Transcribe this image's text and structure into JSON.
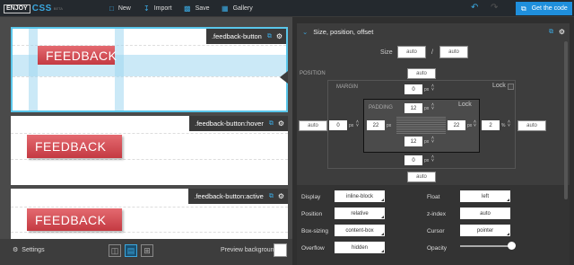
{
  "topbar": {
    "logo_enjoy": "ENJOY",
    "logo_css": "CSS",
    "logo_beta": "BETA",
    "new_label": "New",
    "import_label": "Import",
    "save_label": "Save",
    "gallery_label": "Gallery",
    "get_code_label": "Get the code"
  },
  "previews": [
    {
      "selector": ".feedback-button",
      "button_text": "FEEDBACK",
      "selected": true
    },
    {
      "selector": ".feedback-button:hover",
      "button_text": "FEEDBACK",
      "selected": false
    },
    {
      "selector": ".feedback-button:active",
      "button_text": "FEEDBACK",
      "selected": false
    }
  ],
  "footer": {
    "settings_label": "Settings",
    "layouts": [
      "columns",
      "rows",
      "grid"
    ],
    "active_layout": "rows",
    "preview_bg_label": "Preview background",
    "preview_bg_color": "#ffffff"
  },
  "panel": {
    "title": "Size, position, offset",
    "size": {
      "label": "Size",
      "width": "auto",
      "separator": "/",
      "height": "auto"
    },
    "position": {
      "label": "POSITION",
      "top": "auto",
      "bottom": "auto",
      "left": "auto",
      "right": "auto"
    },
    "margin": {
      "label": "MARGIN",
      "lock_label": "Lock",
      "top": "0",
      "bottom": "0",
      "left": "0",
      "right": "2",
      "top_unit": "px",
      "bottom_unit": "px",
      "left_unit": "px",
      "right_unit": "%"
    },
    "padding": {
      "label": "PADDING",
      "lock_label": "Lock",
      "top": "12",
      "bottom": "12",
      "left": "22",
      "right": "22",
      "unit": "px"
    }
  },
  "properties": {
    "display": {
      "label": "Display",
      "value": "inline-block"
    },
    "float": {
      "label": "Float",
      "value": "left"
    },
    "position": {
      "label": "Position",
      "value": "relative"
    },
    "zindex": {
      "label": "z-index",
      "value": "auto"
    },
    "boxsizing": {
      "label": "Box-sizing",
      "value": "content-box"
    },
    "cursor": {
      "label": "Cursor",
      "value": "pointer"
    },
    "overflow": {
      "label": "Overflow",
      "value": "hidden"
    },
    "opacity": {
      "label": "Opacity",
      "value": 1
    }
  },
  "colors": {
    "accent": "#1f8fdc",
    "button": "#d9454d",
    "selection": "#5ac6ea"
  }
}
